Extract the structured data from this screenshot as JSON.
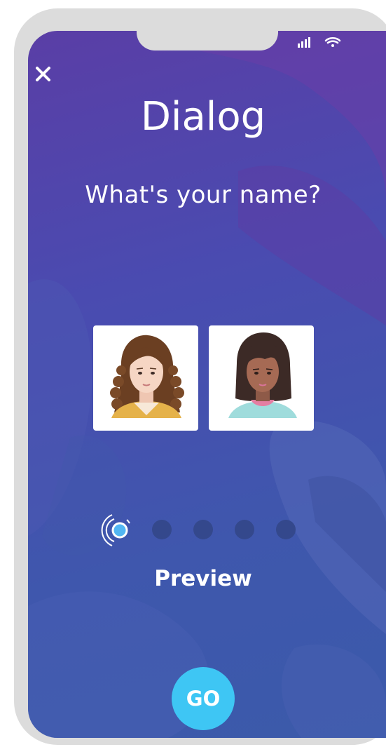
{
  "header": {
    "close_icon": "close-icon",
    "status_icons": [
      "signal-icon",
      "wifi-icon"
    ]
  },
  "main": {
    "title": "Dialog",
    "question": "What's your name?",
    "avatars": [
      {
        "icon": "woman-curly-hair-avatar"
      },
      {
        "icon": "woman-bangs-avatar"
      }
    ],
    "progress": {
      "total_steps": 5,
      "current_step": 1
    },
    "preview_label": "Preview"
  },
  "footer": {
    "go_label": "GO"
  },
  "colors": {
    "background_start": "#5a3ea6",
    "background_end": "#3b5aaa",
    "accent": "#3ec6f4",
    "inactive_dot": "#34488c",
    "frame": "#dcdcdc"
  }
}
